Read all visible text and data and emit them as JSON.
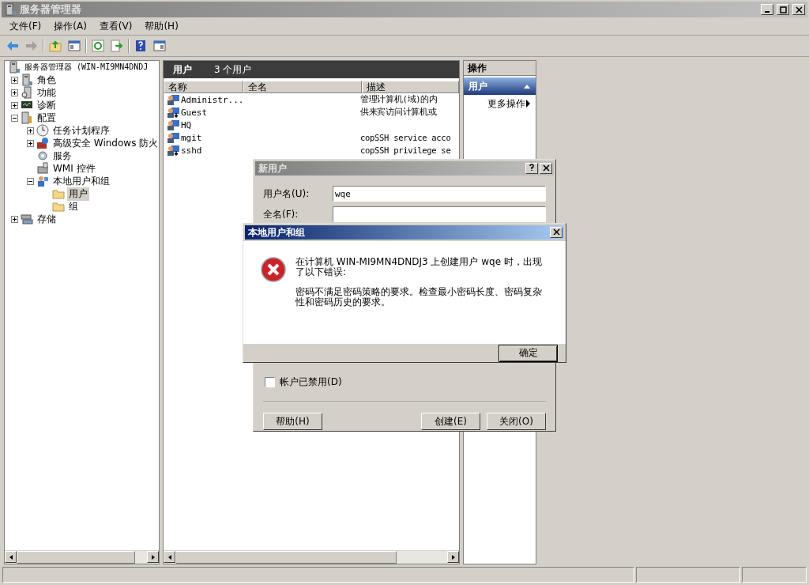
{
  "window": {
    "title": "服务器管理器"
  },
  "menu": [
    "文件(F)",
    "操作(A)",
    "查看(V)",
    "帮助(H)"
  ],
  "tree": {
    "label": "服务器管理器 (WIN-MI9MN4DNDJ",
    "selected": false,
    "children": [
      {
        "label": "角色",
        "expanded": false,
        "selected": false
      },
      {
        "label": "功能",
        "expanded": false,
        "selected": false
      },
      {
        "label": "诊断",
        "expanded": false,
        "selected": false
      },
      {
        "label": "配置",
        "expanded": true,
        "selected": false,
        "children": [
          {
            "label": "任务计划程序",
            "expanded": false,
            "selected": false
          },
          {
            "label": "高级安全 Windows 防火",
            "expanded": false,
            "selected": false
          },
          {
            "label": "服务",
            "selected": false
          },
          {
            "label": "WMI 控件",
            "selected": false
          },
          {
            "label": "本地用户和组",
            "expanded": true,
            "selected": false,
            "children": [
              {
                "label": "用户",
                "selected": true
              },
              {
                "label": "组",
                "selected": false
              }
            ]
          }
        ]
      },
      {
        "label": "存储",
        "expanded": false,
        "selected": false
      }
    ]
  },
  "list_header": {
    "title": "用户",
    "count": "3 个用户"
  },
  "table": {
    "columns": [
      "名称",
      "全名",
      "描述"
    ],
    "rows": [
      {
        "name": "Administr...",
        "disabled": false,
        "description": "管理计算机(域)的内"
      },
      {
        "name": "Guest",
        "disabled": true,
        "description": "供来宾访问计算机或"
      },
      {
        "name": "HQ",
        "disabled": false
      },
      {
        "name": "mgit",
        "disabled": false,
        "description": "copSSH service acco"
      },
      {
        "name": "sshd",
        "disabled": true,
        "description": "copSSH privilege se"
      }
    ]
  },
  "actions": {
    "title": "操作",
    "section": {
      "label": "用户",
      "expanded": true
    },
    "items": [
      "更多操作"
    ]
  },
  "new_user_dialog": {
    "title": "新用户",
    "fields": [
      {
        "label": "用户名(U):",
        "value": "wqe"
      },
      {
        "label": "全名(F):"
      }
    ],
    "checkbox": {
      "label": "帐户已禁用(D)",
      "checked": false
    },
    "buttons": [
      "帮助(H)",
      "创建(E)",
      "关闭(O)"
    ]
  },
  "error_dialog": {
    "title": "本地用户和组",
    "message": "在计算机 WIN-MI9MN4DNDJ3 上创建用户 wqe 时，出现了以下错误:",
    "detail": "密码不满足密码策略的要求。检查最小密码长度、密码复杂性和密码历史的要求。",
    "button": "确定"
  }
}
